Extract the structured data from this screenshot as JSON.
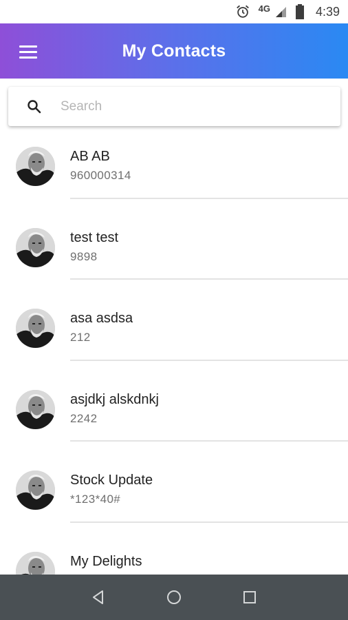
{
  "status_bar": {
    "network": "4G",
    "time": "4:39",
    "icons": [
      "alarm-icon",
      "signal-icon",
      "battery-icon"
    ]
  },
  "app_bar": {
    "title": "My Contacts",
    "menu_icon": "hamburger-menu-icon",
    "gradient_start": "#8e4fd8",
    "gradient_end": "#2a89f3"
  },
  "search": {
    "placeholder": "Search",
    "value": "",
    "icon": "search-icon"
  },
  "contacts": [
    {
      "name": "AB AB",
      "phone": "960000314"
    },
    {
      "name": "test test",
      "phone": "9898"
    },
    {
      "name": "asa asdsa",
      "phone": "212"
    },
    {
      "name": "asjdkj alskdnkj",
      "phone": "2242"
    },
    {
      "name": "Stock Update",
      "phone": "*123*40#"
    },
    {
      "name": "My Delights",
      "phone": ""
    }
  ],
  "nav_bar": {
    "buttons": [
      "back-icon",
      "home-icon",
      "recents-icon"
    ],
    "background": "#4a5054"
  }
}
